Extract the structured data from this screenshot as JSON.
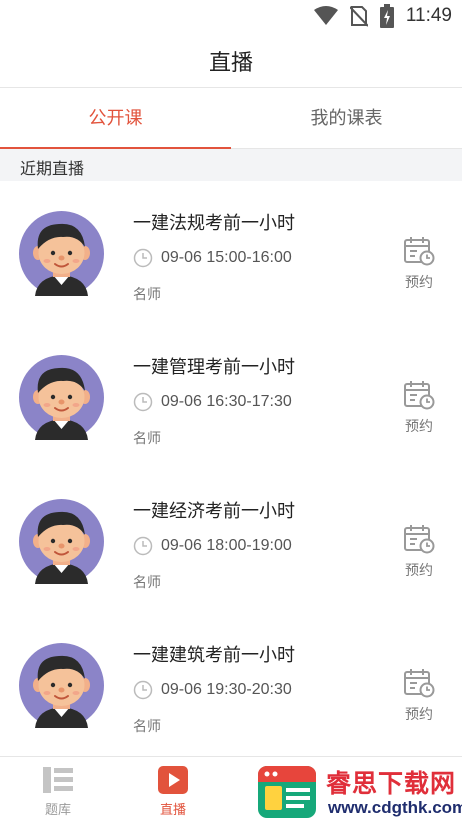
{
  "status_bar": {
    "time": "11:49",
    "icons": [
      "wifi-icon",
      "no-sim-icon",
      "battery-charging-icon"
    ]
  },
  "header": {
    "title": "直播"
  },
  "tabs": [
    {
      "label": "公开课",
      "active": true
    },
    {
      "label": "我的课表",
      "active": false
    }
  ],
  "section": {
    "title": "近期直播"
  },
  "courses": [
    {
      "title": "一建法规考前一小时",
      "time": "09-06 15:00-16:00",
      "teacher": "名师",
      "action": "预约"
    },
    {
      "title": "一建管理考前一小时",
      "time": "09-06 16:30-17:30",
      "teacher": "名师",
      "action": "预约"
    },
    {
      "title": "一建经济考前一小时",
      "time": "09-06 18:00-19:00",
      "teacher": "名师",
      "action": "预约"
    },
    {
      "title": "一建建筑考前一小时",
      "time": "09-06 19:30-20:30",
      "teacher": "名师",
      "action": "预约"
    }
  ],
  "bottom_nav": [
    {
      "label": "题库",
      "icon": "question-bank-icon",
      "active": false
    },
    {
      "label": "直播",
      "icon": "live-play-icon",
      "active": true
    }
  ],
  "watermark": {
    "title": "睿思下载网",
    "url": "www.cdgthk.com"
  },
  "colors": {
    "accent": "#e2533c",
    "avatar_bg": "#8b84c8",
    "section_bg": "#f3f4f6"
  }
}
